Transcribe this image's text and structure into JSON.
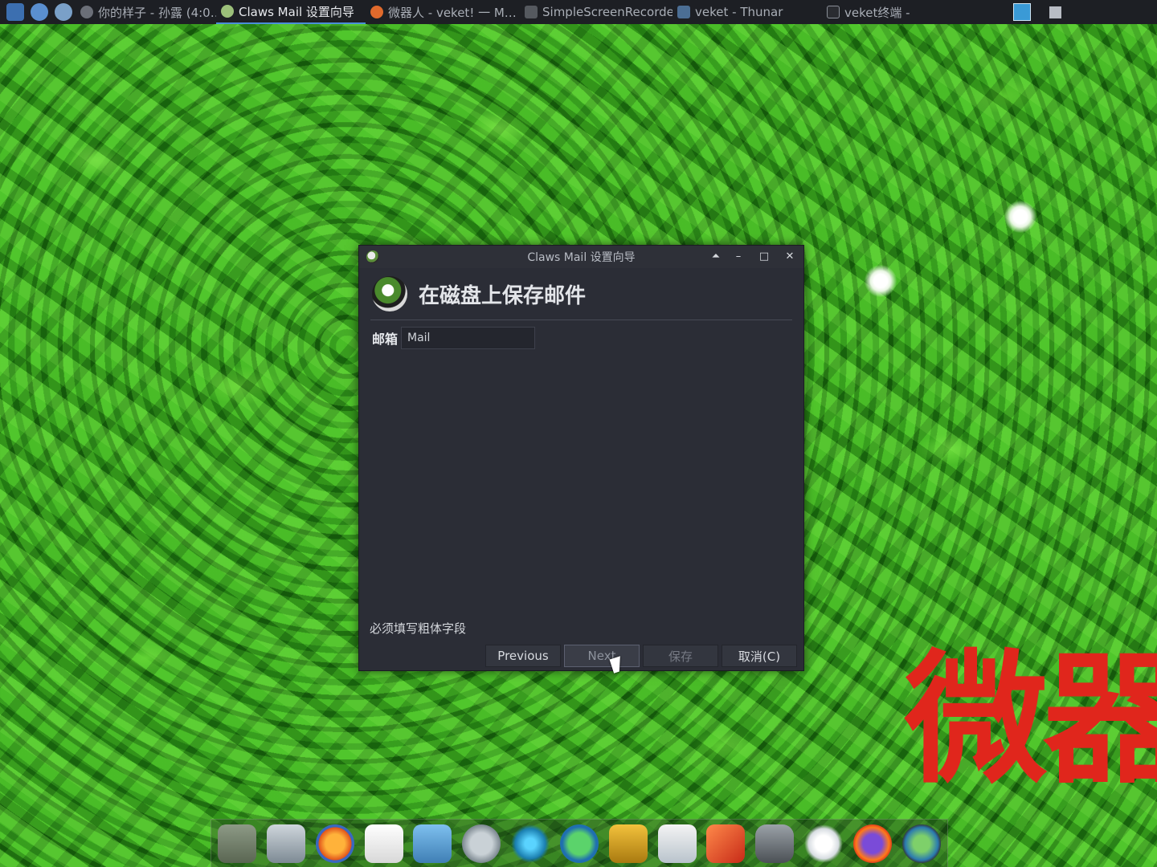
{
  "taskbar": {
    "tasks": [
      {
        "label": "你的样子 - 孙露 (4:0…",
        "active": false
      },
      {
        "label": "Claws Mail 设置向导",
        "active": true
      },
      {
        "label": "微器人 - veket! 一 M…",
        "active": false
      },
      {
        "label": "SimpleScreenRecorder",
        "active": false
      },
      {
        "label": "veket - Thunar",
        "active": false
      },
      {
        "label": "veket终端 -",
        "active": false
      }
    ]
  },
  "dialog": {
    "window_title": "Claws Mail 设置向导",
    "controls": {
      "shade": "⏶",
      "minimize": "–",
      "maximize": "□",
      "close": "✕"
    },
    "header_title": "在磁盘上保存邮件",
    "mailbox": {
      "label": "邮箱",
      "value": "Mail"
    },
    "hint": "必须填写粗体字段",
    "buttons": {
      "previous": "Previous",
      "next": "Next",
      "save": "保存",
      "cancel": "取消(C)"
    }
  },
  "watermark": "微器",
  "dock_icons": [
    "desktop-icon",
    "monitor-icon",
    "browser-icon",
    "notepad-icon",
    "image-viewer-icon",
    "music-icon",
    "network-icon",
    "media-player-icon",
    "door-icon",
    "presentation-icon",
    "rocket-icon",
    "drive-icon",
    "brightness-icon",
    "firefox-icon",
    "globe-icon"
  ],
  "colors": {
    "accent": "#4a8fd8",
    "watermark": "#e0261c",
    "dialog_bg": "#2b2d36"
  }
}
